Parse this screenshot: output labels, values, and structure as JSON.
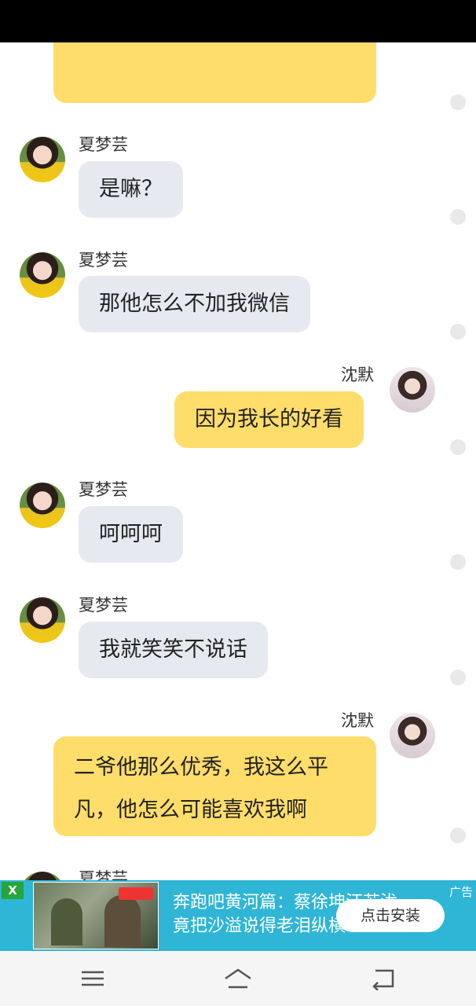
{
  "chat": {
    "messages": [
      {
        "sender": "夏梦芸",
        "side": "left",
        "text": "是嘛？"
      },
      {
        "sender": "夏梦芸",
        "side": "left",
        "text": "那他怎么不加我微信"
      },
      {
        "sender": "沈默",
        "side": "right",
        "text": "因为我长的好看"
      },
      {
        "sender": "夏梦芸",
        "side": "left",
        "text": "呵呵呵"
      },
      {
        "sender": "夏梦芸",
        "side": "left",
        "text": "我就笑笑不说话"
      },
      {
        "sender": "沈默",
        "side": "right",
        "text": "二爷他那么优秀，我这么平凡，他怎么可能喜欢我啊"
      },
      {
        "sender": "夏梦芸",
        "side": "left",
        "text": ""
      }
    ]
  },
  "ad": {
    "close_label": "X",
    "tag": "广告",
    "line1": "奔跑吧黄河篇：蔡徐坤汪苏泷",
    "line2": "竟把沙溢说得老泪纵横",
    "button": "点击安装"
  },
  "icons": {
    "menu": "menu-icon",
    "home": "home-icon",
    "back": "back-icon"
  },
  "colors": {
    "left_bubble": "#e6e9ef",
    "right_bubble": "#ffdd6b",
    "ad_bg": "#2fb5d6"
  }
}
